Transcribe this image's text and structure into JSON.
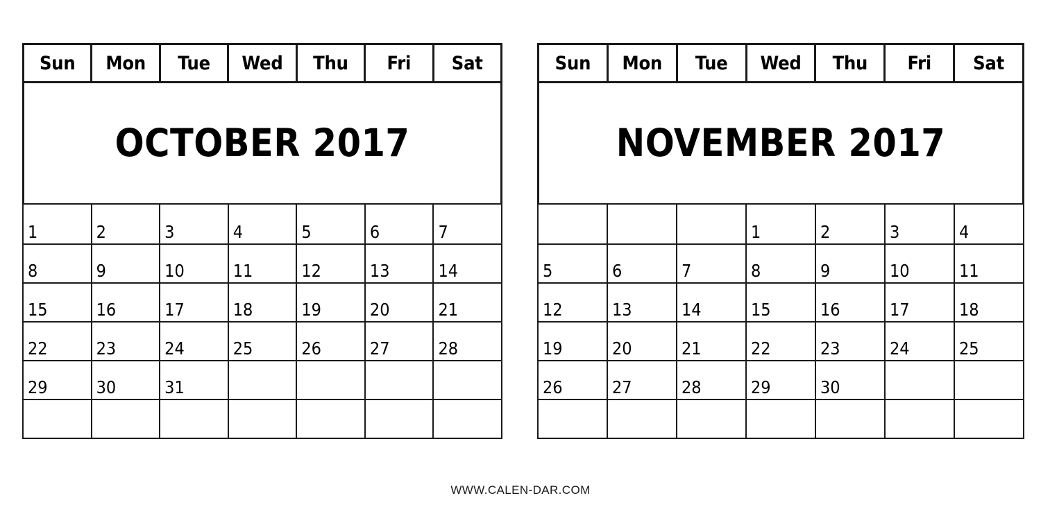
{
  "page": {
    "background_color": "#ffffff",
    "ink_color": "#000000",
    "border_color": "#1a1a1a"
  },
  "weekday_headers": [
    "Sun",
    "Mon",
    "Tue",
    "Wed",
    "Thu",
    "Fri",
    "Sat"
  ],
  "months": [
    {
      "id": "october",
      "title": "OCTOBER 2017",
      "month_name": "OCTOBER",
      "year": "2017",
      "first_day_of_week": "Sun",
      "days_in_month": 31,
      "weeks": [
        [
          "1",
          "2",
          "3",
          "4",
          "5",
          "6",
          "7"
        ],
        [
          "8",
          "9",
          "10",
          "11",
          "12",
          "13",
          "14"
        ],
        [
          "15",
          "16",
          "17",
          "18",
          "19",
          "20",
          "21"
        ],
        [
          "22",
          "23",
          "24",
          "25",
          "26",
          "27",
          "28"
        ],
        [
          "29",
          "30",
          "31",
          "",
          "",
          "",
          ""
        ],
        [
          "",
          "",
          "",
          "",
          "",
          "",
          ""
        ]
      ]
    },
    {
      "id": "november",
      "title": "NOVEMBER 2017",
      "month_name": "NOVEMBER",
      "year": "2017",
      "first_day_of_week": "Wed",
      "days_in_month": 30,
      "weeks": [
        [
          "",
          "",
          "",
          "1",
          "2",
          "3",
          "4"
        ],
        [
          "5",
          "6",
          "7",
          "8",
          "9",
          "10",
          "11"
        ],
        [
          "12",
          "13",
          "14",
          "15",
          "16",
          "17",
          "18"
        ],
        [
          "19",
          "20",
          "21",
          "22",
          "23",
          "24",
          "25"
        ],
        [
          "26",
          "27",
          "28",
          "29",
          "30",
          "",
          ""
        ],
        [
          "",
          "",
          "",
          "",
          "",
          "",
          ""
        ]
      ]
    }
  ],
  "footer": {
    "text": "WWW.CALEN-DAR.COM"
  }
}
